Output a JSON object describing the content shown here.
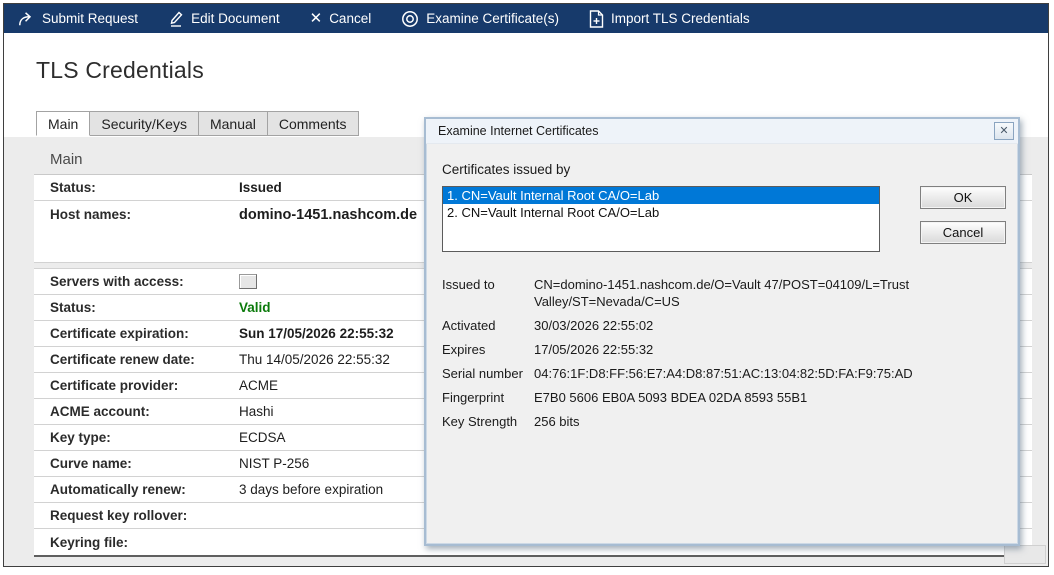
{
  "toolbar": {
    "items": [
      {
        "label": "Submit Request",
        "icon": "submit-arrow-icon"
      },
      {
        "label": "Edit Document",
        "icon": "edit-pencil-icon"
      },
      {
        "label": "Cancel",
        "icon": "cancel-x-icon"
      },
      {
        "label": "Examine Certificate(s)",
        "icon": "examine-circle-icon"
      },
      {
        "label": "Import TLS Credentials",
        "icon": "import-document-icon"
      }
    ]
  },
  "page": {
    "title": "TLS Credentials"
  },
  "tabs": [
    {
      "label": "Main",
      "active": true
    },
    {
      "label": "Security/Keys",
      "active": false
    },
    {
      "label": "Manual",
      "active": false
    },
    {
      "label": "Comments",
      "active": false
    }
  ],
  "form": {
    "section_title": "Main",
    "rows": [
      {
        "label": "Status:",
        "value": "Issued"
      },
      {
        "label": "Host names:",
        "value": "domino-1451.nashcom.de"
      },
      {
        "label": "Servers with access:",
        "value": ""
      },
      {
        "label": "Status:",
        "value": "Valid"
      },
      {
        "label": "Certificate expiration:",
        "value": "Sun 17/05/2026 22:55:32"
      },
      {
        "label": "Certificate renew date:",
        "value": "Thu 14/05/2026 22:55:32"
      },
      {
        "label": "Certificate provider:",
        "value": "ACME"
      },
      {
        "label": "ACME account:",
        "value": "Hashi"
      },
      {
        "label": "Key type:",
        "value": "ECDSA"
      },
      {
        "label": "Curve name:",
        "value": "NIST P-256"
      },
      {
        "label": "Automatically renew:",
        "value": "3 days before expiration"
      },
      {
        "label": "Request key rollover:",
        "value": ""
      },
      {
        "label": "Keyring file:",
        "value": ""
      }
    ]
  },
  "dialog": {
    "title": "Examine Internet Certificates",
    "close_glyph": "✕",
    "list_label": "Certificates issued by",
    "list_items": [
      {
        "text": "1. CN=Vault Internal Root CA/O=Lab",
        "selected": true
      },
      {
        "text": "2. CN=Vault Internal Root CA/O=Lab",
        "selected": false
      }
    ],
    "buttons": {
      "ok": "OK",
      "cancel": "Cancel"
    },
    "details": [
      {
        "label": "Issued to",
        "value": "CN=domino-1451.nashcom.de/O=Vault 47/POST=04109/L=Trust Valley/ST=Nevada/C=US"
      },
      {
        "label": "Activated",
        "value": "30/03/2026 22:55:02"
      },
      {
        "label": "Expires",
        "value": "17/05/2026 22:55:32"
      },
      {
        "label": "Serial number",
        "value": "04:76:1F:D8:FF:56:E7:A4:D8:87:51:AC:13:04:82:5D:FA:F9:75:AD"
      },
      {
        "label": "Fingerprint",
        "value": "E7B0 5606 EB0A 5093 BDEA 02DA 8593 55B1"
      },
      {
        "label": "Key Strength",
        "value": "256 bits"
      }
    ]
  },
  "colors": {
    "toolbar_navy": "#173a6b",
    "selection_blue": "#0078d7",
    "valid_green": "#0b7a0b",
    "dialog_border": "#a7bcd2"
  }
}
